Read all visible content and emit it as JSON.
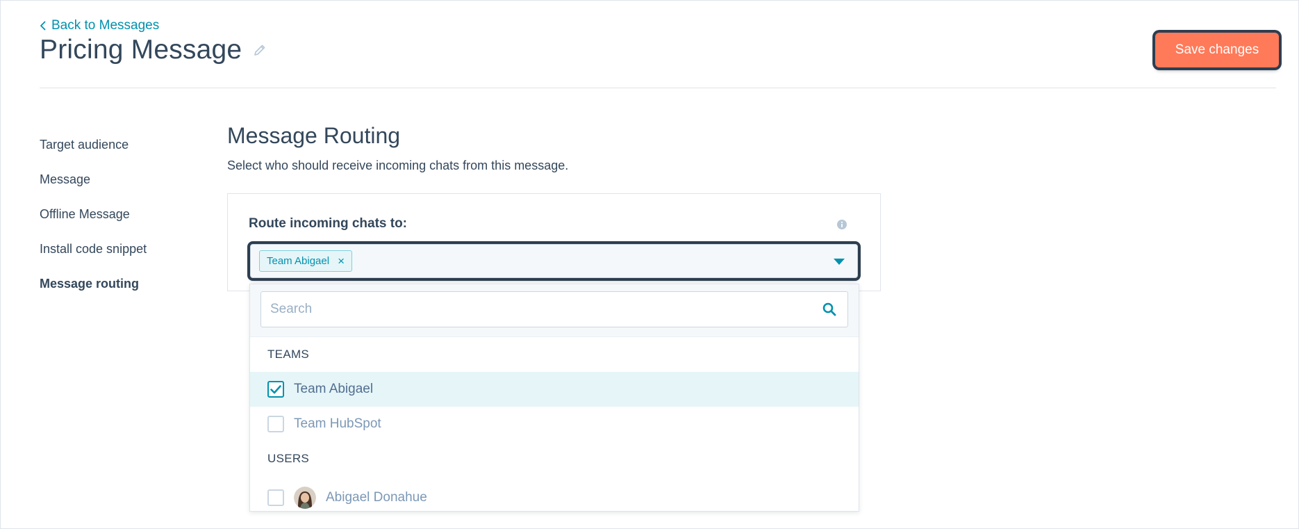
{
  "header": {
    "back_label": "Back to Messages",
    "title": "Pricing Message",
    "save_label": "Save changes"
  },
  "sidebar": {
    "items": [
      {
        "label": "Target audience"
      },
      {
        "label": "Message"
      },
      {
        "label": "Offline Message"
      },
      {
        "label": "Install code snippet"
      },
      {
        "label": "Message routing",
        "active": true
      }
    ]
  },
  "main": {
    "title": "Message Routing",
    "subtitle": "Select who should receive incoming chats from this message.",
    "route_label": "Route incoming chats to:",
    "selected_tag": "Team Abigael"
  },
  "dropdown": {
    "search_placeholder": "Search",
    "teams_header": "TEAMS",
    "teams": [
      {
        "label": "Team Abigael",
        "checked": true
      },
      {
        "label": "Team HubSpot",
        "checked": false
      }
    ],
    "users_header": "USERS",
    "users": [
      {
        "label": "Abigael Donahue",
        "checked": false
      }
    ]
  },
  "colors": {
    "accent": "#0091ae",
    "primary_button": "#ff7a59",
    "text": "#33475b",
    "highlight_ring": "#2d3e50"
  }
}
